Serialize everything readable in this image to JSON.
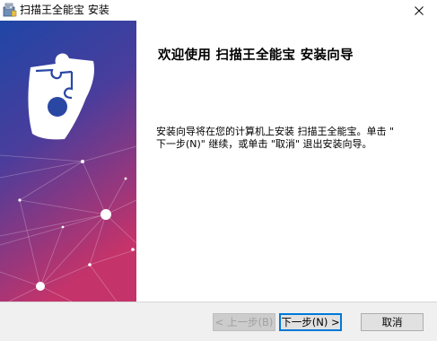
{
  "window": {
    "title": "扫描王全能宝 安装",
    "close_symbol": "✕"
  },
  "welcome": {
    "heading": "欢迎使用  扫描王全能宝  安装向导",
    "body_line1": "安装向导将在您的计算机上安装 扫描王全能宝。单击 \"",
    "body_line2": "下一步(N)\" 继续，或单击 \"取消\" 退出安装向导。"
  },
  "buttons": {
    "back_label": "< 上一步(B)",
    "next_label": "下一步(N) >",
    "cancel_label": "取消"
  },
  "icons": {
    "app_icon": "installer-icon",
    "close_icon": "close-icon",
    "logo": "puzzle-logo-icon"
  },
  "colors": {
    "banner_top": "#1f46a6",
    "banner_bottom": "#c4336a",
    "accent_focus": "#0078d7"
  }
}
